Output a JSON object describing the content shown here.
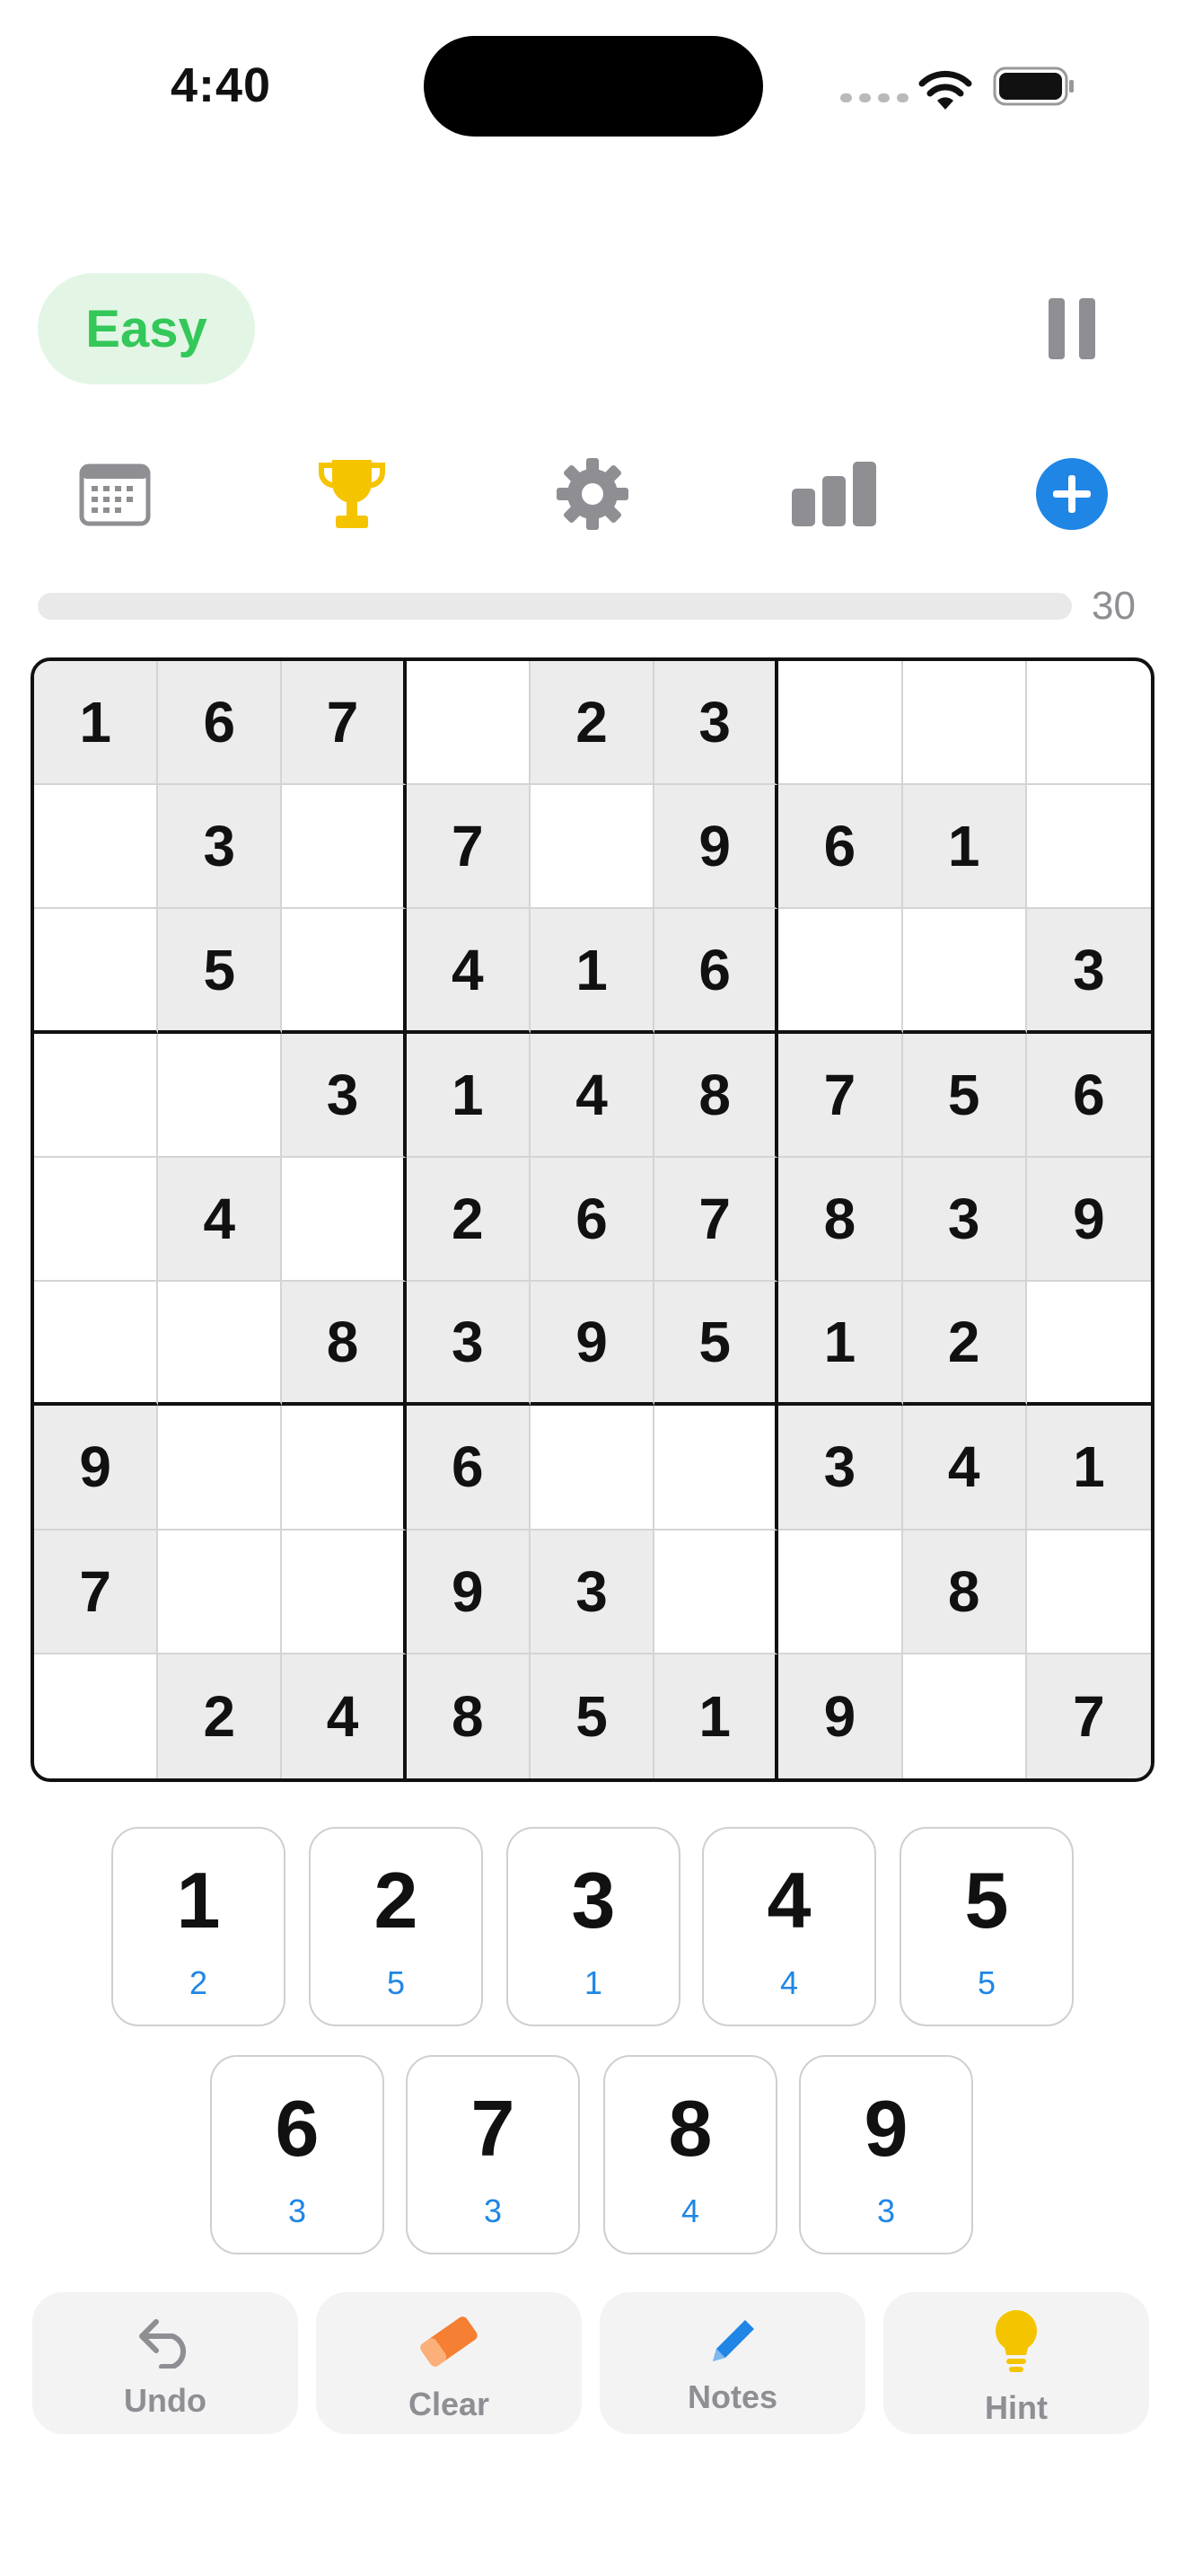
{
  "status_bar": {
    "time": "4:40"
  },
  "header": {
    "difficulty": "Easy",
    "pause_icon": "pause-icon"
  },
  "toolbar": {
    "icons": [
      "calendar-icon",
      "trophy-icon",
      "gear-icon",
      "stats-bars-icon",
      "plus-circle-icon"
    ]
  },
  "progress": {
    "value_fraction": 0.0,
    "label": "30"
  },
  "board": {
    "rows": [
      [
        "1",
        "6",
        "7",
        "",
        "2",
        "3",
        "",
        "",
        ""
      ],
      [
        "",
        "3",
        "",
        "7",
        "",
        "9",
        "6",
        "1",
        ""
      ],
      [
        "",
        "5",
        "",
        "4",
        "1",
        "6",
        "",
        "",
        "3"
      ],
      [
        "",
        "",
        "3",
        "1",
        "4",
        "8",
        "7",
        "5",
        "6"
      ],
      [
        "",
        "4",
        "",
        "2",
        "6",
        "7",
        "8",
        "3",
        "9"
      ],
      [
        "",
        "",
        "8",
        "3",
        "9",
        "5",
        "1",
        "2",
        ""
      ],
      [
        "9",
        "",
        "",
        "6",
        "",
        "",
        "3",
        "4",
        "1"
      ],
      [
        "7",
        "",
        "",
        "9",
        "3",
        "",
        "",
        "8",
        ""
      ],
      [
        "",
        "2",
        "4",
        "8",
        "5",
        "1",
        "9",
        "",
        "7"
      ]
    ]
  },
  "number_pad": [
    {
      "digit": "1",
      "count": "2"
    },
    {
      "digit": "2",
      "count": "5"
    },
    {
      "digit": "3",
      "count": "1"
    },
    {
      "digit": "4",
      "count": "4"
    },
    {
      "digit": "5",
      "count": "5"
    },
    {
      "digit": "6",
      "count": "3"
    },
    {
      "digit": "7",
      "count": "3"
    },
    {
      "digit": "8",
      "count": "4"
    },
    {
      "digit": "9",
      "count": "3"
    }
  ],
  "actions": {
    "undo": "Undo",
    "clear": "Clear",
    "notes": "Notes",
    "hint": "Hint"
  },
  "colors": {
    "accent_green": "#34c759",
    "accent_blue": "#1f86e6",
    "trophy_yellow": "#f5c400",
    "eraser_orange": "#f57f32",
    "hint_yellow": "#f5c400"
  }
}
